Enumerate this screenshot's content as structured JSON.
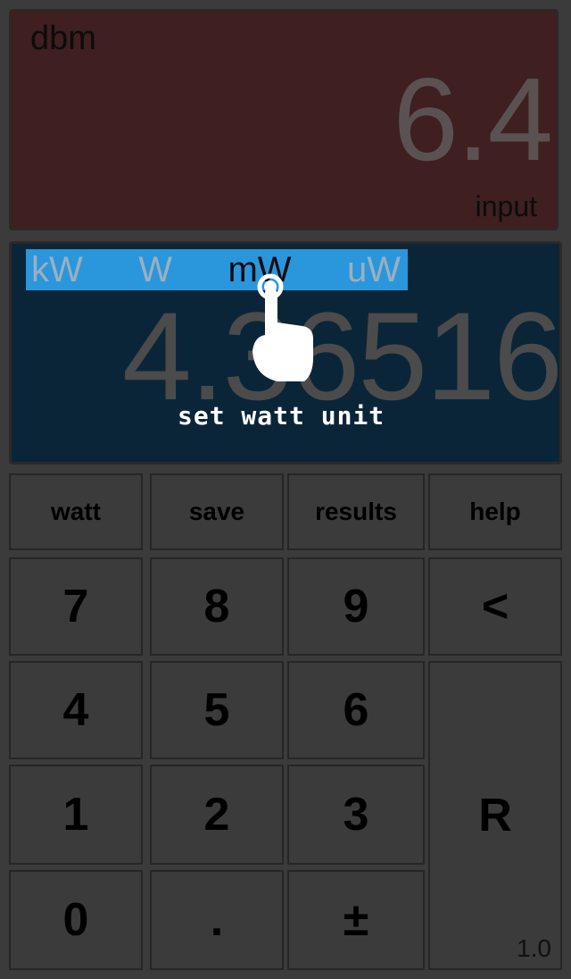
{
  "input_display": {
    "unit_label": "dbm",
    "value": "6.4",
    "caption": "input"
  },
  "result_display": {
    "value": "4.36516",
    "units": [
      "kW",
      "W",
      "mW",
      "uW"
    ],
    "selected_unit": "mW",
    "hint": "set watt unit"
  },
  "function_keys": {
    "watt": "watt",
    "save": "save",
    "results": "results",
    "help": "help"
  },
  "keypad": {
    "k7": "7",
    "k8": "8",
    "k9": "9",
    "back": "<",
    "k4": "4",
    "k5": "5",
    "k6": "6",
    "k1": "1",
    "k2": "2",
    "k3": "3",
    "reset": "R",
    "k0": "0",
    "dot": ".",
    "sign": "±"
  },
  "version": "1.0",
  "colors": {
    "background": "#3b3b3b",
    "input_panel": "#3f1f1f",
    "result_panel": "#0b2538",
    "unit_bar": "#2a96dc"
  }
}
